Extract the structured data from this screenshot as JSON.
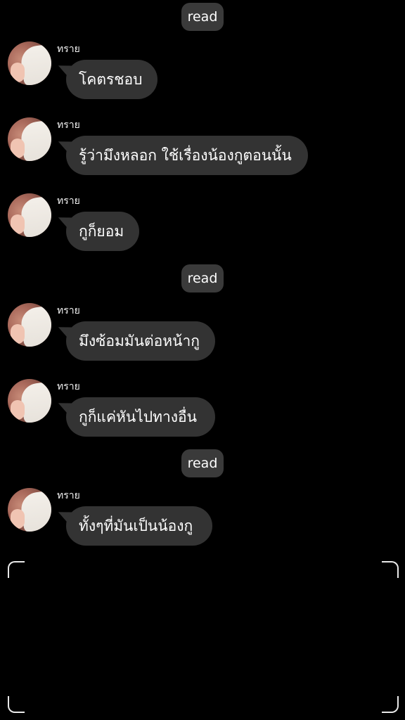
{
  "read_badges": [
    "read",
    "read",
    "read"
  ],
  "sender_name": "ทราย",
  "messages": [
    {
      "text": "โคตรชอบ"
    },
    {
      "text": "รู้ว่ามึงหลอก ใช้เรื่องน้องกูตอนนั้น"
    },
    {
      "text": "กูก็ยอม"
    },
    {
      "text": "มึงซ้อมมันต่อหน้ากู"
    },
    {
      "text": "กูก็แค่หันไปทางอื่น"
    },
    {
      "text": "ทั้งๆที่มันเป็นน้องกู"
    }
  ]
}
